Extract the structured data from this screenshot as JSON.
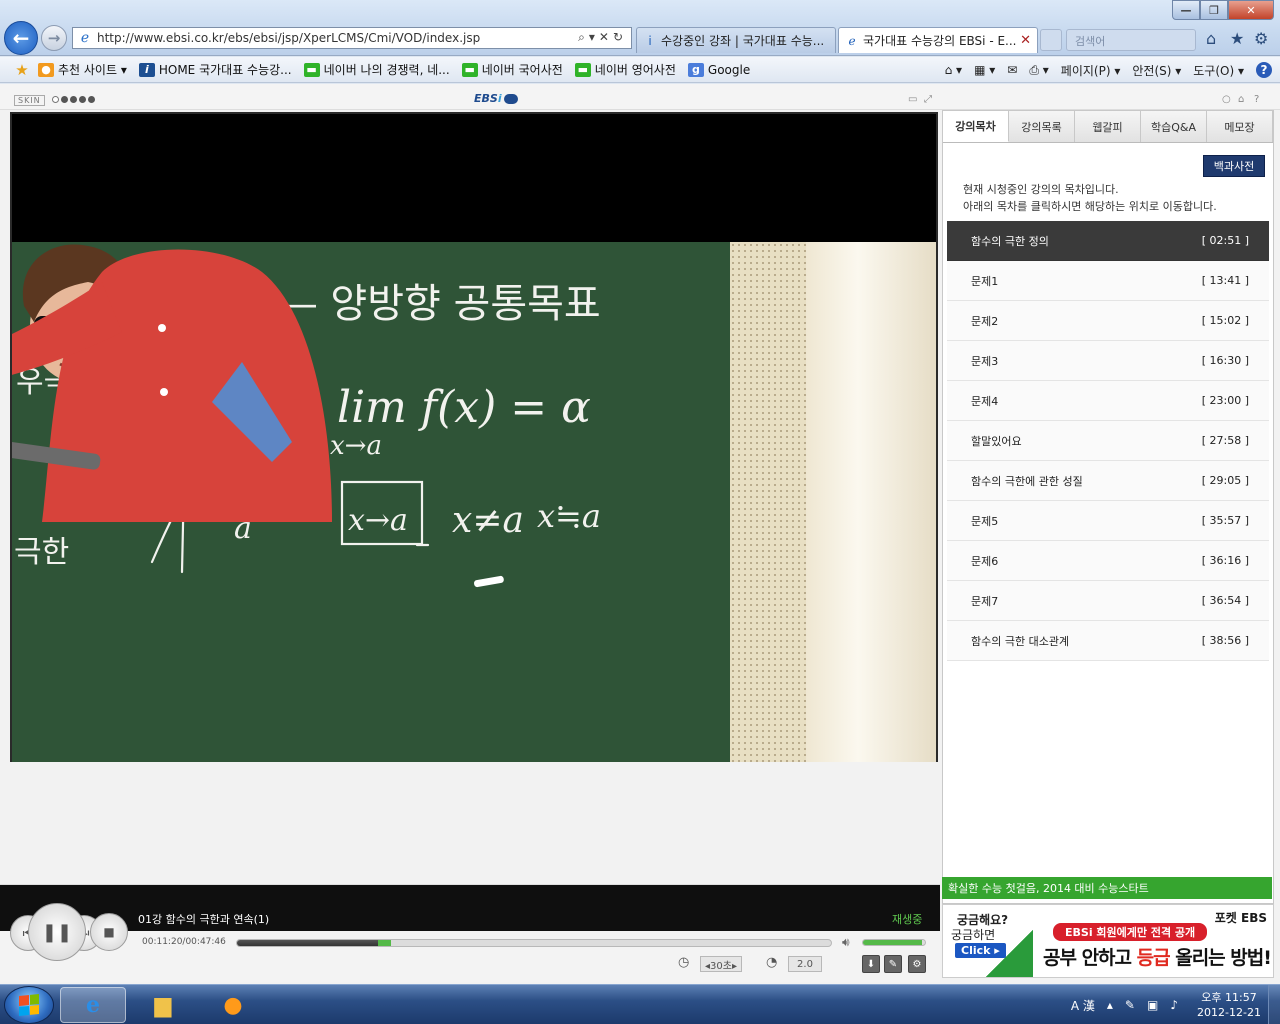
{
  "browser": {
    "address": "http://www.ebsi.co.kr/ebs/ebsi/jsp/XperLCMS/Cmi/VOD/index.jsp",
    "tabs": [
      {
        "label": "수강중인 강좌 | 국가대표 수능..."
      },
      {
        "label": "국가대표 수능강의 EBSi - E...",
        "close": "✕"
      }
    ],
    "search_placeholder": "검색어",
    "window_controls": {
      "minimize": "—",
      "maximize": "❐",
      "close": "✕"
    }
  },
  "favorites": [
    {
      "icon": "star-icon",
      "label": ""
    },
    {
      "icon": "orange-icon",
      "label": "추천 사이트 ▾"
    },
    {
      "icon": "ebsi-icon",
      "label": "HOME  국가대표 수능강..."
    },
    {
      "icon": "naver-icon",
      "label": "네이버   나의 경쟁력, 네..."
    },
    {
      "icon": "naver-icon",
      "label": "네이버 국어사전"
    },
    {
      "icon": "naver-icon",
      "label": "네이버 영어사전"
    },
    {
      "icon": "google-icon",
      "label": "Google"
    }
  ],
  "command_bar": {
    "page": "페이지(P) ▾",
    "safety": "안전(S) ▾",
    "tools": "도구(O) ▾",
    "help": "?"
  },
  "player": {
    "skin_label": "SKIN",
    "logo": {
      "text": "EBS",
      "i": "i"
    },
    "lecture_title": "01강 함수의 극한과 연속(1)",
    "status": "재생중",
    "time": "00:11:20/00:47:46",
    "progress": 0.237,
    "buffer_end": 0.26,
    "volume": 0.95,
    "skip": "◂30초▸",
    "speed": "2.0"
  },
  "panel": {
    "tabs": [
      "강의목차",
      "강의목록",
      "웹갈피",
      "학습Q&A",
      "메모장"
    ],
    "active_tab": 0,
    "encyclopedia_button": "백과사전",
    "desc_line1": "현재 시청중인 강의의 목차입니다.",
    "desc_line2": "아래의 목차를 클릭하시면 해당하는 위치로 이동합니다.",
    "chapters": [
      {
        "title": "함수의 극한 정의",
        "time": "[ 02:51 ]"
      },
      {
        "title": "문제1",
        "time": "[ 13:41 ]"
      },
      {
        "title": "문제2",
        "time": "[ 15:02 ]"
      },
      {
        "title": "문제3",
        "time": "[ 16:30 ]"
      },
      {
        "title": "문제4",
        "time": "[ 23:00 ]"
      },
      {
        "title": "할말있어요",
        "time": "[ 27:58 ]"
      },
      {
        "title": "함수의 극한에 관한 성질",
        "time": "[ 29:05 ]"
      },
      {
        "title": "문제5",
        "time": "[ 35:57 ]"
      },
      {
        "title": "문제6",
        "time": "[ 36:16 ]"
      },
      {
        "title": "문제7",
        "time": "[ 36:54 ]"
      },
      {
        "title": "함수의 극한 대소관계",
        "time": "[ 38:56 ]"
      }
    ],
    "footer": "확실한 수능 첫걸음, 2014 대비 수능스타트"
  },
  "ad": {
    "q1": "궁금해요?",
    "q2": "궁금하면",
    "click": "Click ▸",
    "brand": "포켓 EBS",
    "banner": "EBSi 회원에게만 전격 공개",
    "main_1": "공부 안하고 ",
    "main_red": "등급",
    "main_2": " 올리는 방법!"
  },
  "blackboard": {
    "heading": "(2) 극한 — 양방향 공통목표",
    "side_1": "우극한",
    "side_2": "극한",
    "formula": "lim f(x) = α",
    "formula_sub": "x→a",
    "box": "x→a",
    "cond_1": "x≠a",
    "cond_2": "x≒a",
    "alpha": "α",
    "a": "a"
  },
  "taskbar": {
    "tray_ime": "A 漢",
    "clock_time": "오후 11:57",
    "clock_date": "2012-12-21"
  },
  "colors": {
    "accent_green": "#54b948",
    "panel_active": "#3a3a3a",
    "encyclopedia": "#1f3a6e",
    "board": "#2f5437"
  }
}
